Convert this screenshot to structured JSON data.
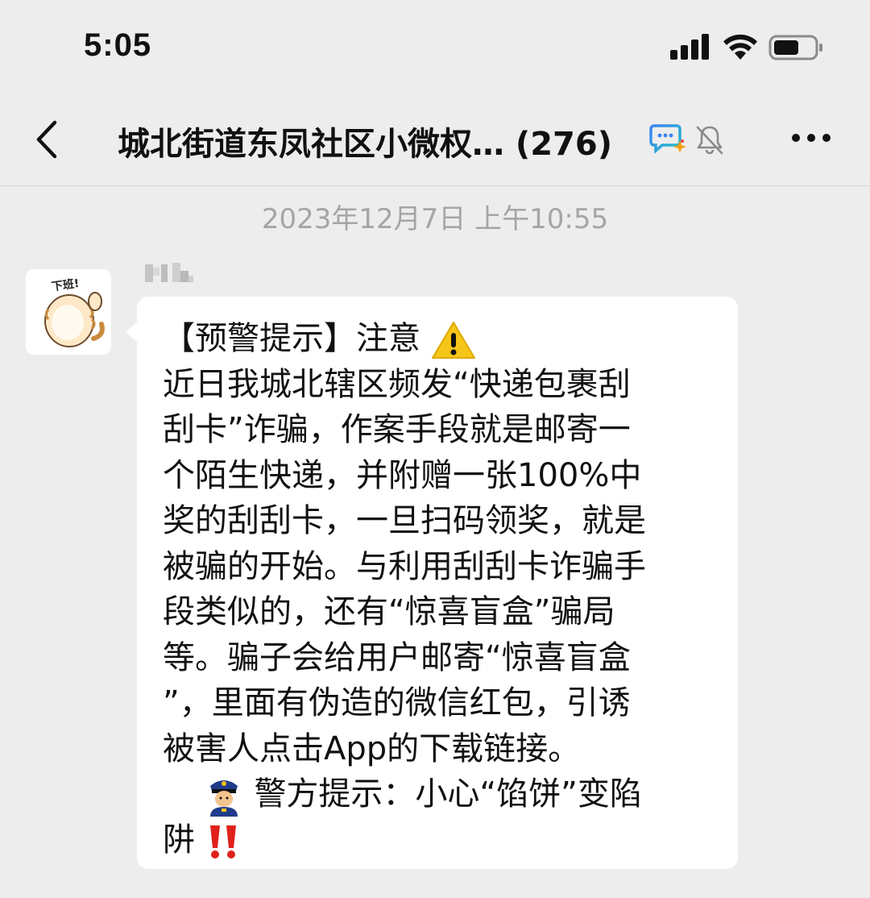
{
  "status_bar": {
    "time": "5:05"
  },
  "nav": {
    "title": "城北街道东凤社区小微权… (276)",
    "icons": [
      "back-icon",
      "chat-bot-icon",
      "mute-bell-icon",
      "more-icon"
    ]
  },
  "timestamp": "2023年12月7日 上午10:55",
  "message": {
    "sender_name": "",
    "avatar": "cat-sticker-avatar",
    "avatar_text": "下班!",
    "lines": [
      "【预警提示】注意",
      "近日我城北辖区频发“快递包裹刮",
      "刮卡”诈骗，作案手段就是邮寄一",
      "个陌生快递，并附赠一张100%中",
      "奖的刮刮卡，一旦扫码领奖，就是",
      "被骗的开始。与利用刮刮卡诈骗手",
      "段类似的，还有“惊喜盲盒”骗局",
      "等。骗子会给用户邮寄“惊喜盲盒",
      "”，里面有伪造的微信红包，引诱",
      "被害人点击App的下载链接。",
      "警方提示：小心“馅饼”变陷",
      "阱"
    ]
  },
  "colors": {
    "background": "#ededed",
    "bubble": "#ffffff",
    "timestamp": "#a5a5a5",
    "warning_yellow": "#f5c518",
    "exclamation_red": "#e0211b"
  }
}
